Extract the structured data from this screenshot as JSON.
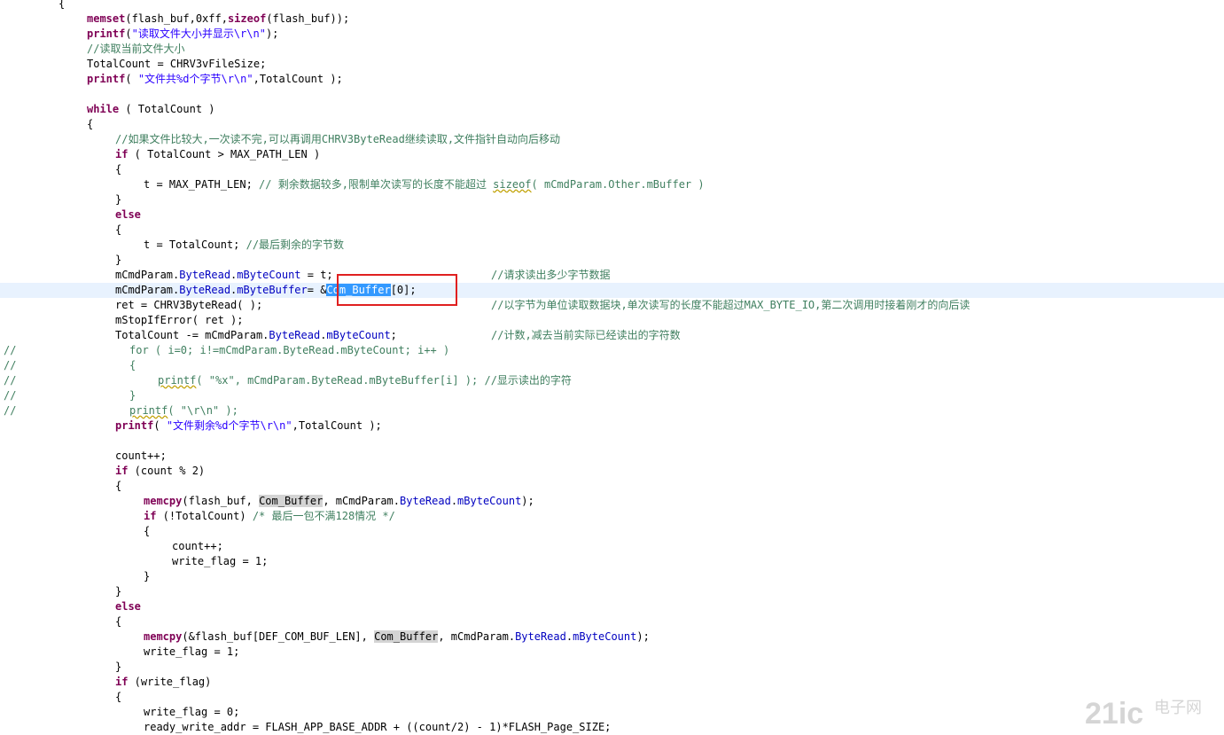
{
  "editor": {
    "lines": [
      [
        [
          "",
          "{"
        ]
      ],
      [
        [
          "kw",
          "memset"
        ],
        [
          "",
          "(flash_buf,0xff,"
        ],
        [
          "kw",
          "sizeof"
        ],
        [
          "",
          "(flash_buf));"
        ]
      ],
      [
        [
          "kw",
          "printf"
        ],
        [
          "",
          "("
        ],
        [
          "str",
          "\"读取文件大小并显示\\r\\n\""
        ],
        [
          "",
          ");"
        ]
      ],
      [
        [
          "cmt",
          "//读取当前文件大小"
        ]
      ],
      [
        [
          "",
          "TotalCount = CHRV3vFileSize;"
        ]
      ],
      [
        [
          "kw",
          "printf"
        ],
        [
          "",
          "( "
        ],
        [
          "str",
          "\"文件共%d个字节\\r\\n\""
        ],
        [
          "",
          ",TotalCount );"
        ]
      ],
      [],
      [
        [
          "kw",
          "while"
        ],
        [
          "",
          " ( TotalCount )"
        ]
      ],
      [
        [
          "",
          "{"
        ]
      ],
      [
        [
          "cmt",
          "//如果文件比较大,一次读不完,可以再调用CHRV3ByteRead继续读取,文件指针自动向后移动"
        ]
      ],
      [
        [
          "kw",
          "if"
        ],
        [
          "",
          " ( TotalCount > MAX_PATH_LEN )"
        ]
      ],
      [
        [
          "",
          "{"
        ]
      ],
      [
        [
          "",
          "t = MAX_PATH_LEN; "
        ],
        [
          "cmt",
          "// 剩余数据较多,限制单次读写的长度不能超过 "
        ],
        [
          "cmt squig",
          "sizeof"
        ],
        [
          "cmt",
          "( mCmdParam.Other.mBuffer )"
        ]
      ],
      [
        [
          "",
          "}"
        ]
      ],
      [
        [
          "kw",
          "else"
        ]
      ],
      [
        [
          "",
          "{"
        ]
      ],
      [
        [
          "",
          "t = TotalCount; "
        ],
        [
          "cmt",
          "//最后剩余的字节数"
        ]
      ],
      [
        [
          "",
          "}"
        ]
      ],
      [
        [
          "",
          "mCmdParam."
        ],
        [
          "fld",
          "ByteRead"
        ],
        [
          "",
          "."
        ],
        [
          "fld",
          "mByteCount"
        ],
        [
          "",
          " = t;"
        ]
      ],
      [
        [
          "",
          "mCmdParam."
        ],
        [
          "fld",
          "ByteRead"
        ],
        [
          "",
          "."
        ],
        [
          "fld",
          "mByteBuffer"
        ],
        [
          "",
          "= &"
        ],
        [
          "sel",
          "Com_Buffer"
        ],
        [
          "",
          "[0];"
        ]
      ],
      [
        [
          "",
          "ret = CHRV3ByteRead( );"
        ]
      ],
      [
        [
          "",
          "mStopIfError( ret );"
        ]
      ],
      [
        [
          "",
          "TotalCount -= mCmdParam."
        ],
        [
          "fld",
          "ByteRead"
        ],
        [
          "",
          "."
        ],
        [
          "fld",
          "mByteCount"
        ],
        [
          "",
          ";"
        ]
      ],
      [
        [
          "cmt",
          "for ( i=0; i!=mCmdParam.ByteRead.mByteCount; i++ )"
        ]
      ],
      [
        [
          "cmt",
          "{"
        ]
      ],
      [
        [
          "cmt squig",
          "printf"
        ],
        [
          "cmt",
          "( \"%x\", mCmdParam.ByteRead.mByteBuffer[i] ); //显示读出的字符"
        ]
      ],
      [
        [
          "cmt",
          "}"
        ]
      ],
      [
        [
          "cmt squig",
          "printf"
        ],
        [
          "cmt",
          "( \"\\r\\n\" );"
        ]
      ],
      [
        [
          "kw",
          "printf"
        ],
        [
          "",
          "( "
        ],
        [
          "str",
          "\"文件剩余%d个字节\\r\\n\""
        ],
        [
          "",
          ",TotalCount );"
        ]
      ],
      [],
      [
        [
          "",
          "count++;"
        ]
      ],
      [
        [
          "kw",
          "if"
        ],
        [
          "",
          " (count % 2)"
        ]
      ],
      [
        [
          "",
          "{"
        ]
      ],
      [
        [
          "kw",
          "memcpy"
        ],
        [
          "",
          "(flash_buf, "
        ],
        [
          "occ",
          "Com_Buffer"
        ],
        [
          "",
          ", mCmdParam."
        ],
        [
          "fld",
          "ByteRead"
        ],
        [
          "",
          "."
        ],
        [
          "fld",
          "mByteCount"
        ],
        [
          "",
          ");"
        ]
      ],
      [
        [
          "kw",
          "if"
        ],
        [
          "",
          " (!TotalCount) "
        ],
        [
          "cmt",
          "/* 最后一包不满128情况 */"
        ]
      ],
      [
        [
          "",
          "{"
        ]
      ],
      [
        [
          "",
          "count++;"
        ]
      ],
      [
        [
          "",
          "write_flag = 1;"
        ]
      ],
      [
        [
          "",
          "}"
        ]
      ],
      [
        [
          "",
          "}"
        ]
      ],
      [
        [
          "kw",
          "else"
        ]
      ],
      [
        [
          "",
          "{"
        ]
      ],
      [
        [
          "kw",
          "memcpy"
        ],
        [
          "",
          "(&flash_buf[DEF_COM_BUF_LEN], "
        ],
        [
          "occ",
          "Com_Buffer"
        ],
        [
          "",
          ", mCmdParam."
        ],
        [
          "fld",
          "ByteRead"
        ],
        [
          "",
          "."
        ],
        [
          "fld",
          "mByteCount"
        ],
        [
          "",
          ");"
        ]
      ],
      [
        [
          "",
          "write_flag = 1;"
        ]
      ],
      [
        [
          "",
          "}"
        ]
      ],
      [
        [
          "kw",
          "if"
        ],
        [
          "",
          " (write_flag)"
        ]
      ],
      [
        [
          "",
          "{"
        ]
      ],
      [
        [
          "",
          "write_flag = 0;"
        ]
      ],
      [
        [
          "",
          "ready_write_addr = FLASH_APP_BASE_ADDR + ((count/2) - 1)*FLASH_Page_SIZE;"
        ]
      ]
    ],
    "trailing_comments": [
      "",
      "",
      "",
      "",
      "",
      "",
      "",
      "",
      "",
      "",
      "",
      "",
      "",
      "",
      "",
      "",
      "",
      "",
      "//请求读出多少字节数据",
      "",
      "//以字节为单位读取数据块,单次读写的长度不能超过MAX_BYTE_IO,第二次调用时接着刚才的向后读",
      "",
      "//计数,减去当前实际已经读出的字符数"
    ],
    "gutter_marks": [
      "//",
      "//",
      "//",
      "//",
      "//"
    ]
  },
  "watermark": {
    "brand": "21ic",
    "cn": "电子网"
  },
  "colors": {
    "keyword": "#7f0055",
    "string": "#2a00ff",
    "comment": "#3f7f5f",
    "field": "#0000c0",
    "current_line": "#e8f2fe",
    "selection": "#3399ff",
    "annotation_box": "#e02020"
  }
}
